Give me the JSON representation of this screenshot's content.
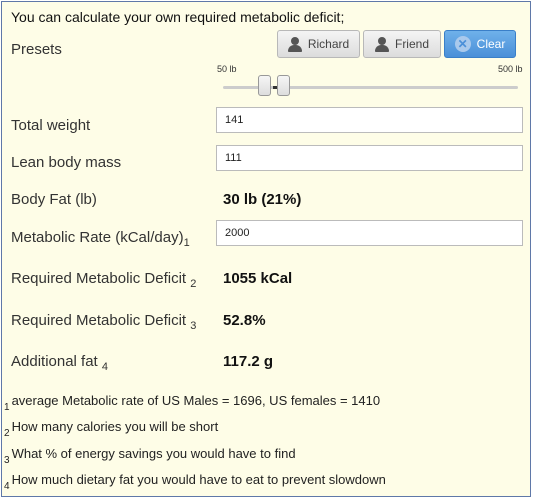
{
  "intro": "You can calculate your own required metabolic deficit;",
  "presets": {
    "label": "Presets",
    "buttons": [
      {
        "label": "Richard",
        "icon": "user-icon"
      },
      {
        "label": "Friend",
        "icon": "user-icon"
      },
      {
        "label": "Clear",
        "icon": "clear-icon",
        "accent": "#4a8fd8"
      }
    ]
  },
  "slider": {
    "min_label": "50 lb",
    "max_label": "500 lb",
    "low_value": 111,
    "high_value": 141
  },
  "rows": {
    "total_weight": {
      "label": "Total weight",
      "value": "141"
    },
    "lean_body_mass": {
      "label": "Lean body mass",
      "value": "111"
    },
    "body_fat": {
      "label": "Body Fat (lb)",
      "value": "30 lb (21%)"
    },
    "metabolic_rate": {
      "label": "Metabolic Rate (kCal/day)",
      "sub": "1",
      "value": "2000"
    },
    "deficit_kcal": {
      "label": "Required Metabolic Deficit",
      "sub": "2",
      "value": "1055 kCal"
    },
    "deficit_pct": {
      "label": "Required Metabolic Deficit",
      "sub": "3",
      "value": "52.8%"
    },
    "additional_fat": {
      "label": "Additional fat",
      "sub": "4",
      "value": "117.2 g"
    }
  },
  "notes": [
    {
      "n": "1",
      "text": "average Metabolic rate of US Males = 1696, US females = 1410"
    },
    {
      "n": "2",
      "text": "How many calories you will be short"
    },
    {
      "n": "3",
      "text": "What % of energy savings you would have to find"
    },
    {
      "n": "4",
      "text": "How much dietary fat you would have to eat to prevent slowdown"
    }
  ]
}
